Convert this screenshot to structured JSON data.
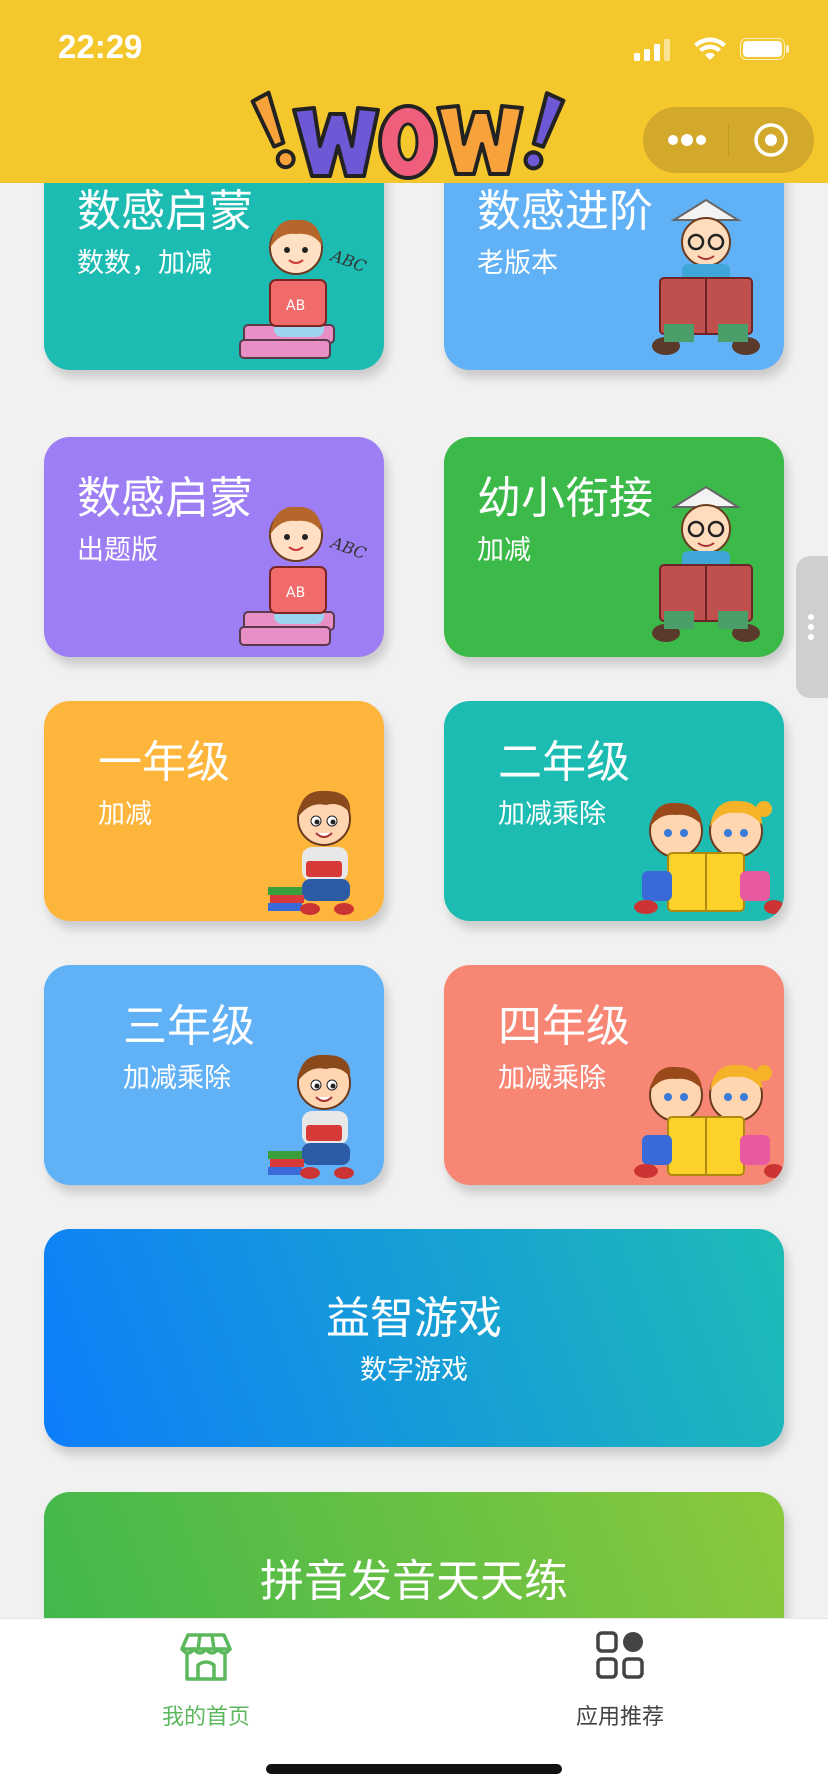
{
  "status_bar": {
    "time": "22:29"
  },
  "header": {
    "logo_text": "WOW",
    "capsule_icons": [
      "more-icon",
      "close-circle-icon"
    ]
  },
  "cards": [
    {
      "title": "数感启蒙",
      "subtitle": "数数，加减",
      "color": "#1dbcb3",
      "illustration": "girl-reading-icon"
    },
    {
      "title": "数感进阶",
      "subtitle": "老版本",
      "color": "#60b1f6",
      "illustration": "boy-reading-icon"
    },
    {
      "title": "数感启蒙",
      "subtitle": "出题版",
      "color": "#9d7ef4",
      "illustration": "girl-reading-icon"
    },
    {
      "title": "幼小衔接",
      "subtitle": "加减",
      "color": "#3cba49",
      "illustration": "boy-reading-icon"
    },
    {
      "title": "一年级",
      "subtitle": "加减",
      "color": "#fdb53c",
      "illustration": "boy-with-books-icon"
    },
    {
      "title": "二年级",
      "subtitle": "加减乘除",
      "color": "#1dbcb3",
      "illustration": "two-kids-reading-icon"
    },
    {
      "title": "三年级",
      "subtitle": "加减乘除",
      "color": "#60b1f6",
      "illustration": "boy-with-books-icon"
    },
    {
      "title": "四年级",
      "subtitle": "加减乘除",
      "color": "#f88675",
      "illustration": "two-kids-reading-icon"
    },
    {
      "title": "益智游戏",
      "subtitle": "数字游戏",
      "gradient": [
        "#0d7dfb",
        "#1ebcb5"
      ]
    },
    {
      "title": "拼音发音天天练",
      "subtitle": "",
      "gradient": [
        "#3fb74c",
        "#8bc93c"
      ]
    }
  ],
  "tabbar": {
    "items": [
      {
        "label": "我的首页",
        "icon": "home-shop-icon",
        "active": true,
        "color": "#5cb85c"
      },
      {
        "label": "应用推荐",
        "icon": "apps-grid-icon",
        "active": false,
        "color": "#444444"
      }
    ]
  }
}
